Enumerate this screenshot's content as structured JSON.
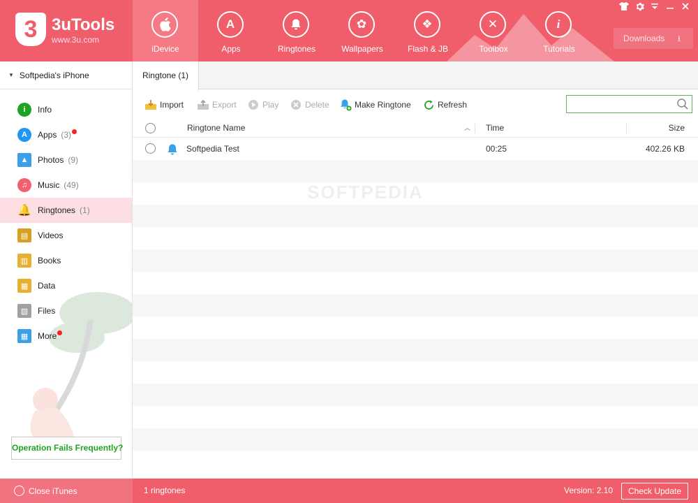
{
  "app": {
    "title": "3uTools",
    "url": "www.3u.com",
    "logo_mark": "3",
    "brand_color": "#f05d6b"
  },
  "nav": {
    "items": [
      {
        "label": "iDevice",
        "icon": "apple-icon",
        "glyph": "",
        "active": true
      },
      {
        "label": "Apps",
        "icon": "app-store-icon",
        "glyph": "A"
      },
      {
        "label": "Ringtones",
        "icon": "bell-icon",
        "glyph": "🔔"
      },
      {
        "label": "Wallpapers",
        "icon": "flower-icon",
        "glyph": "✿"
      },
      {
        "label": "Flash & JB",
        "icon": "dropbox-icon",
        "glyph": "❖"
      },
      {
        "label": "Toolbox",
        "icon": "tools-icon",
        "glyph": "✕"
      },
      {
        "label": "Tutorials",
        "icon": "info-icon",
        "glyph": "i"
      }
    ]
  },
  "window_controls": {
    "skin": "shirt-icon",
    "settings": "gear-icon",
    "menu": "menu-icon",
    "minimize": "minimize-icon",
    "close": "close-icon"
  },
  "downloads": {
    "label": "Downloads"
  },
  "sidebar": {
    "device_name": "Softpedia's iPhone",
    "items": [
      {
        "label": "Info",
        "count": "",
        "icon": "info-circle-icon",
        "color": "#1fa320",
        "glyph": "i",
        "dot": false
      },
      {
        "label": "Apps",
        "count": "(3)",
        "icon": "app-store-icon",
        "color": "#2196f3",
        "glyph": "A",
        "dot": true
      },
      {
        "label": "Photos",
        "count": "(9)",
        "icon": "photo-icon",
        "color": "#3aa0e8",
        "glyph": "▲",
        "dot": false
      },
      {
        "label": "Music",
        "count": "(49)",
        "icon": "music-icon",
        "color": "#f06070",
        "glyph": "♫",
        "dot": false
      },
      {
        "label": "Ringtones",
        "count": "(1)",
        "icon": "bell-icon",
        "color": "#3aa0e8",
        "glyph": "🔔",
        "dot": false,
        "active": true
      },
      {
        "label": "Videos",
        "count": "",
        "icon": "film-icon",
        "color": "#d8a020",
        "glyph": "▤",
        "dot": false
      },
      {
        "label": "Books",
        "count": "",
        "icon": "book-icon",
        "color": "#e8b030",
        "glyph": "▥",
        "dot": false
      },
      {
        "label": "Data",
        "count": "",
        "icon": "data-icon",
        "color": "#e8b030",
        "glyph": "▦",
        "dot": false
      },
      {
        "label": "Files",
        "count": "",
        "icon": "files-icon",
        "color": "#a0a0a0",
        "glyph": "▧",
        "dot": false
      },
      {
        "label": "More",
        "count": "",
        "icon": "grid-icon",
        "color": "#3aa0e8",
        "glyph": "▦",
        "dot": true
      }
    ],
    "help_button": "Operation Fails Frequently?"
  },
  "main": {
    "tab": "Ringtone (1)",
    "toolbar": {
      "import": "Import",
      "export": "Export",
      "play": "Play",
      "delete": "Delete",
      "make_ringtone": "Make Ringtone",
      "refresh": "Refresh"
    },
    "search": {
      "placeholder": "",
      "value": ""
    },
    "columns": {
      "name": "Ringtone Name",
      "time": "Time",
      "size": "Size"
    },
    "rows": [
      {
        "name": "Softpedia Test",
        "time": "00:25",
        "size": "402.26 KB"
      }
    ],
    "watermark": "SOFTPEDIA"
  },
  "statusbar": {
    "close_itunes": "Close iTunes",
    "count": "1 ringtones",
    "version": "Version: 2.10",
    "check_update": "Check Update"
  }
}
